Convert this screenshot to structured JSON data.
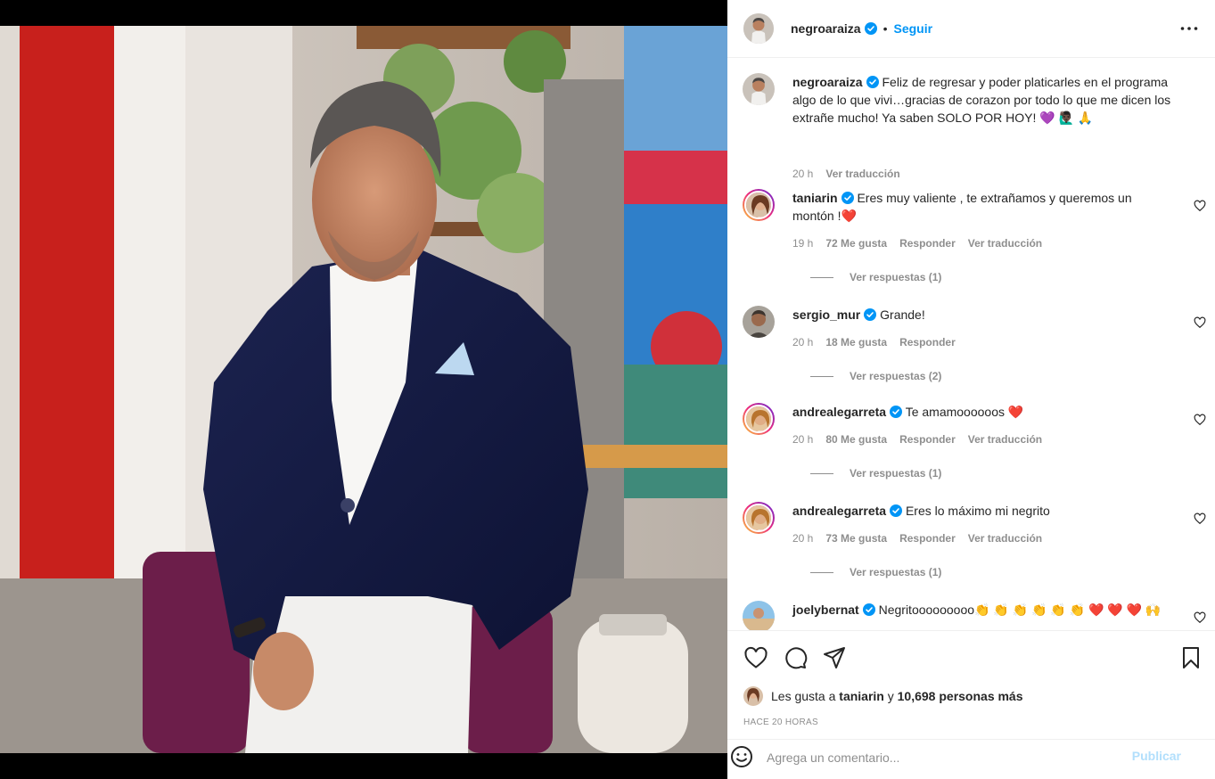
{
  "post": {
    "author": "negroaraiza",
    "follow_label": "Seguir",
    "separator": "•",
    "caption": {
      "username": "negroaraiza",
      "text": "Feliz de regresar y poder platicarles en el programa algo de lo que vivi…gracias de corazon por todo lo que me dicen los extrañe mucho! Ya saben SOLO POR HOY! 💜 🙋🏿‍♂️ 🙏",
      "time": "20 h",
      "translate": "Ver traducción"
    }
  },
  "comments": [
    {
      "username": "taniarin",
      "text": "Eres muy valiente , te extrañamos y queremos un montón !❤️",
      "time": "19 h",
      "likes": "72 Me gusta",
      "reply": "Responder",
      "translate": "Ver traducción",
      "replies": "Ver respuestas (1)"
    },
    {
      "username": "sergio_mur",
      "text": "Grande!",
      "time": "20 h",
      "likes": "18 Me gusta",
      "reply": "Responder",
      "replies": "Ver respuestas (2)"
    },
    {
      "username": "andrealegarreta",
      "text": "Te amamoooooos ❤️",
      "time": "20 h",
      "likes": "80 Me gusta",
      "reply": "Responder",
      "translate": "Ver traducción",
      "replies": "Ver respuestas (1)"
    },
    {
      "username": "andrealegarreta",
      "text": "Eres lo máximo mi negrito",
      "time": "20 h",
      "likes": "73 Me gusta",
      "reply": "Responder",
      "translate": "Ver traducción",
      "replies": "Ver respuestas (1)"
    },
    {
      "username": "joelybernat",
      "text": "Negritooooooooo👏 👏 👏 👏 👏 👏 ❤️ ❤️ ❤️ 🙌"
    }
  ],
  "likes_line": {
    "prefix": "Les gusta a",
    "user": "taniarin",
    "and": "y",
    "others": "10,698 personas más"
  },
  "timestamp": "HACE 20 HORAS",
  "composer": {
    "placeholder": "Agrega un comentario...",
    "publish": "Publicar"
  },
  "colors": {
    "accent": "#0095f6",
    "publish_disabled": "#b2dffc",
    "muted": "#8e8e8e"
  }
}
